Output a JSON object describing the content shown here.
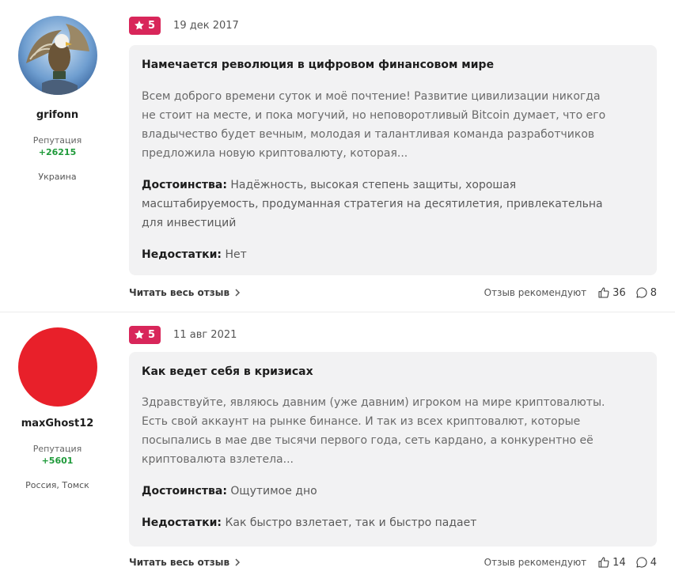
{
  "reviews": [
    {
      "author": "grifonn",
      "reputation_label": "Репутация",
      "reputation": "+26215",
      "location": "Украина",
      "rating": "5",
      "date": "19 дек 2017",
      "title": "Намечается революция в цифровом финансовом мире",
      "text_lines": [
        "Всем доброго времени суток и моё почтение! Развитие цивилизации никогда",
        "не стоит на месте, и пока могучий, но неповоротливый Bitcoin думает, что его",
        "владычество будет вечным, молодая и талантливая команда разработчиков",
        "предложила новую криптовалюту, которая..."
      ],
      "pros_label": "Достоинства:",
      "pros_lines": [
        "Надёжность, высокая степень защиты, хорошая",
        "масштабируемость, продуманная стратегия на десятилетия, привлекательна",
        "для инвестиций"
      ],
      "cons_label": "Недостатки:",
      "cons": "Нет",
      "read_more": "Читать весь отзыв",
      "recommend": "Отзыв рекомендуют",
      "likes": "36",
      "comments": "8"
    },
    {
      "author": "maxGhost12",
      "reputation_label": "Репутация",
      "reputation": "+5601",
      "location": "Россия, Томск",
      "rating": "5",
      "date": "11 авг 2021",
      "title": "Как ведет себя в кризисах",
      "text_lines": [
        "Здравствуйте, являюсь давним (уже давним) игроком на мире криптовалюты.",
        "Есть свой аккаунт на рынке бинансе. И так из всех криптовалют, которые",
        "посыпались в мае две тысячи первого года, сеть кардано, а конкурентно её",
        "криптовалюта взлетела..."
      ],
      "pros_label": "Достоинства:",
      "pros": "Ощутимое дно",
      "cons_label": "Недостатки:",
      "cons": "Как быстро взлетает, так и быстро падает",
      "read_more": "Читать весь отзыв",
      "recommend": "Отзыв рекомендуют",
      "likes": "14",
      "comments": "4"
    }
  ],
  "colors": {
    "rating_badge": "#d8265a",
    "reputation": "#1f9a3a",
    "card_bg": "#f2f2f3",
    "avatar2": "#e8202a"
  },
  "icons": [
    "star-icon",
    "chevron-right-icon",
    "thumbs-up-icon",
    "comment-icon",
    "eagle-avatar"
  ]
}
